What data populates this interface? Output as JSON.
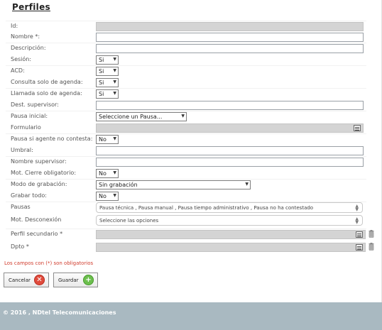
{
  "page": {
    "title": "Perfiles"
  },
  "fields": {
    "id": {
      "label": "Id:"
    },
    "nombre": {
      "label": "Nombre *:"
    },
    "descripcion": {
      "label": "Descripción:"
    },
    "sesion": {
      "label": "Sesión:",
      "value": "Si"
    },
    "acd": {
      "label": "ACD:",
      "value": "Si"
    },
    "consulta_agenda": {
      "label": "Consulta solo de agenda:",
      "value": "Si"
    },
    "llamada_agenda": {
      "label": "Llamada solo de agenda:",
      "value": "Si"
    },
    "dest_supervisor": {
      "label": "Dest. supervisor:"
    },
    "pausa_inicial": {
      "label": "Pausa inicial:",
      "value": "Seleccione un Pausa..."
    },
    "formulario": {
      "label": "Formulario"
    },
    "pausa_no_contesta": {
      "label": "Pausa si agente no contesta:",
      "value": "No"
    },
    "umbral": {
      "label": "Umbral:"
    },
    "nombre_supervisor": {
      "label": "Nombre supervisor:"
    },
    "mot_cierre": {
      "label": "Mot. Cierre obligatorio:",
      "value": "No"
    },
    "modo_grabacion": {
      "label": "Modo de grabación:",
      "value": "Sin grabación"
    },
    "grabar_todo": {
      "label": "Grabar todo:",
      "value": "No"
    },
    "pausas": {
      "label": "Pausas",
      "value": "Pausa técnica , Pausa manual , Pausa tiempo administrativo , Pausa no ha contestado"
    },
    "mot_desconexion": {
      "label": "Mot. Desconexión",
      "value": "Seleccione las opciones"
    },
    "perfil_secundario": {
      "label": "Perfil secundario *"
    },
    "dpto": {
      "label": "Dpto *"
    }
  },
  "required_note": "Los campos con (*) son obligatorios",
  "buttons": {
    "cancel": "Cancelar",
    "save": "Guardar"
  },
  "icons": {
    "cancel": "close-circle-icon",
    "save": "plus-circle-icon",
    "list": "list-icon",
    "trash": "trash-icon"
  },
  "colors": {
    "footer": "#a9b9c1",
    "note": "#d03a2b",
    "cancel_icon": "#e04b3c",
    "save_icon": "#6cbf4d"
  },
  "footer": "© 2016 , NDtel Telecomunicaciones"
}
